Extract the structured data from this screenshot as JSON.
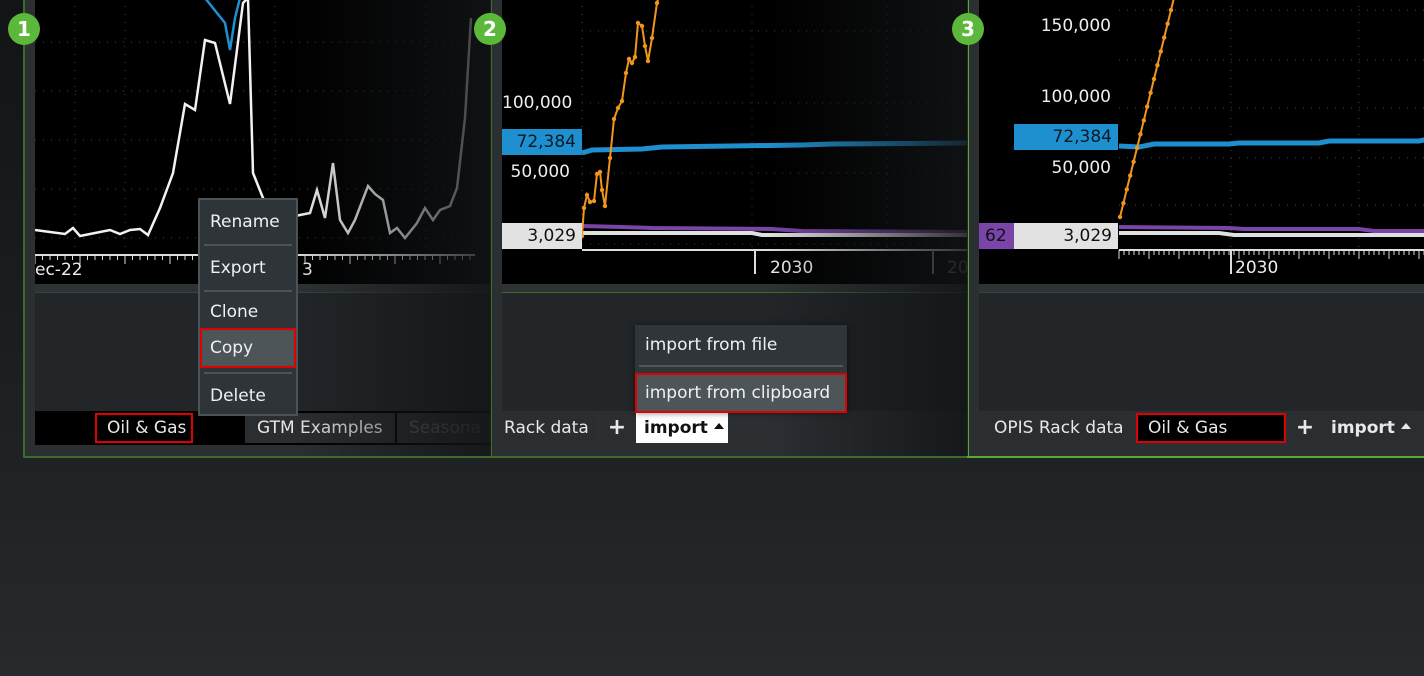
{
  "steps": [
    "1",
    "2",
    "3"
  ],
  "panel1": {
    "chart": {
      "x_labels": [
        "ec-22",
        "3"
      ],
      "series_colors": {
        "primary": "#ffffff",
        "secondary": "#1e8fcf"
      }
    },
    "context_menu": {
      "items": [
        {
          "label": "Rename",
          "highlighted": false
        },
        {
          "label": "Export",
          "highlighted": false
        },
        {
          "label": "Clone",
          "highlighted": false
        },
        {
          "label": "Copy",
          "highlighted": true
        },
        {
          "label": "Delete",
          "highlighted": false
        }
      ]
    },
    "tabs": [
      {
        "label": "Oil & Gas",
        "active": true,
        "highlighted": true
      },
      {
        "label": "GTM Examples",
        "active": false
      },
      {
        "label": "Seasona",
        "active": false
      }
    ]
  },
  "panel2": {
    "chart": {
      "y_labels": [
        "100,000",
        "50,000"
      ],
      "value_boxes": [
        {
          "value": "72,384",
          "color": "#1e8fcf"
        },
        {
          "value": "3,029",
          "color": "#e2e2e2"
        }
      ],
      "x_labels": [
        "2030",
        "20"
      ]
    },
    "import_menu": {
      "items": [
        {
          "label": "import from file",
          "highlighted": false
        },
        {
          "label": "import from clipboard",
          "highlighted": true
        }
      ]
    },
    "tabs": [
      {
        "label": "Rack data"
      },
      {
        "label": "+"
      },
      {
        "label": "import"
      }
    ]
  },
  "panel3": {
    "chart": {
      "y_labels": [
        "150,000",
        "100,000",
        "50,000"
      ],
      "value_boxes": [
        {
          "value": "72,384",
          "color": "#1e8fcf"
        },
        {
          "value": "62",
          "color": "#7b44a8"
        },
        {
          "value": "3,029",
          "color": "#e2e2e2"
        }
      ],
      "x_labels": [
        "2030"
      ]
    },
    "tabs": [
      {
        "label": "OPIS Rack data"
      },
      {
        "label": "Oil & Gas",
        "highlighted": true
      },
      {
        "label": "+"
      },
      {
        "label": "import"
      }
    ]
  },
  "colors": {
    "accent_green": "#5cb83a",
    "highlight_red": "#e00000",
    "series_orange": "#f0961e",
    "series_blue": "#1e8fcf",
    "series_purple": "#7b44a8"
  }
}
